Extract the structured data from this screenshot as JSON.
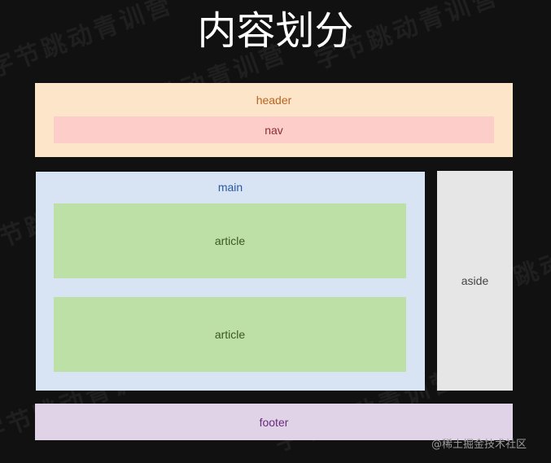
{
  "title": "内容划分",
  "regions": {
    "header": "header",
    "nav": "nav",
    "main": "main",
    "article_1": "article",
    "article_2": "article",
    "aside": "aside",
    "footer": "footer"
  },
  "watermark_text": "字节跳动青训营",
  "credit": "@稀土掘金技术社区",
  "colors": {
    "background": "#111111",
    "header": "#fde5c9",
    "nav": "#fdcdca",
    "main": "#d8e4f3",
    "article": "#bde0a7",
    "aside": "#e6e6e6",
    "footer": "#e0d3e8"
  }
}
